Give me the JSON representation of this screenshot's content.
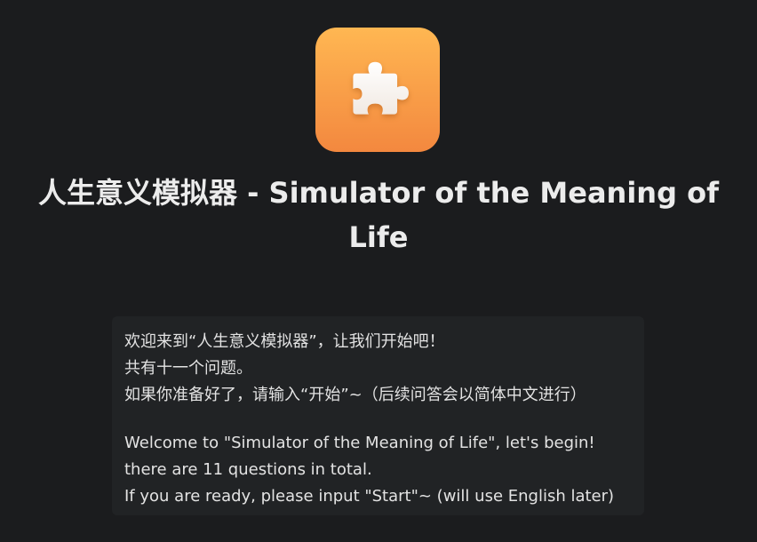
{
  "app": {
    "icon": "puzzle-piece-icon",
    "icon_gradient_top": "#ffb752",
    "icon_gradient_bottom": "#f3883f",
    "title": "人生意义模拟器 - Simulator of the Meaning of Life"
  },
  "message": {
    "zh_lines": [
      "欢迎来到“人生意义模拟器”，让我们开始吧！",
      "共有十一个问题。",
      "如果你准备好了，请输入“开始”~（后续问答会以简体中文进行）"
    ],
    "en_lines": [
      "Welcome to \"Simulator of the Meaning of Life\", let's begin!",
      "there are 11 questions in total.",
      "If you are ready, please input \"Start\"~ (will use English later)"
    ]
  },
  "colors": {
    "background": "#1b1c1e",
    "message_background": "#212325",
    "text": "#e9e9e9"
  }
}
